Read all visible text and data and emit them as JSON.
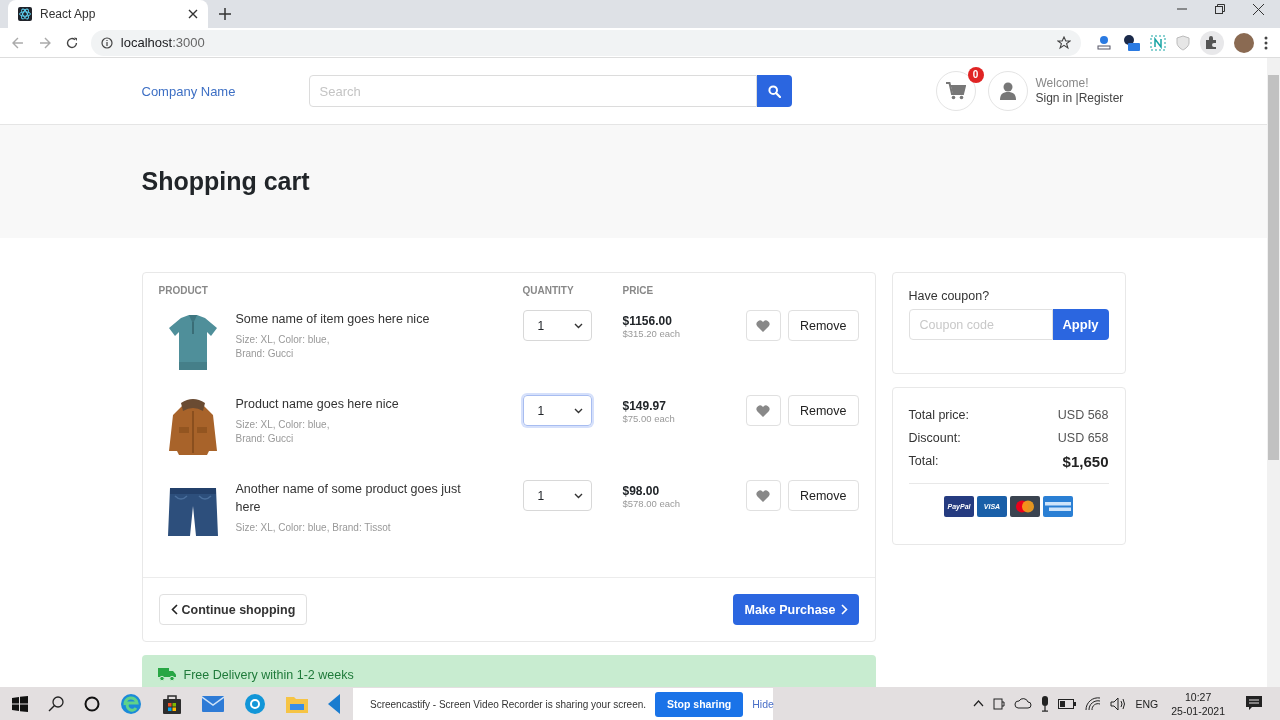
{
  "browser": {
    "tab_title": "React App",
    "url_host": "localhost",
    "url_port": ":3000"
  },
  "header": {
    "brand": "Company Name",
    "search_placeholder": "Search",
    "cart_count": "0",
    "welcome": "Welcome!",
    "sign_in": "Sign in |Register"
  },
  "page_title": "Shopping cart",
  "cart": {
    "columns": [
      "PRODUCT",
      "QUANTITY",
      "PRICE"
    ],
    "items": [
      {
        "name": "Some name of item goes here nice",
        "details": "Size: XL, Color: blue,\nBrand: Gucci",
        "quantity": "1",
        "focused": false,
        "total": "$1156.00",
        "each": "$315.20 each",
        "button": "Remove"
      },
      {
        "name": "Product name goes here nice",
        "details": "Size: XL, Color: blue,\nBrand: Gucci",
        "quantity": "1",
        "focused": true,
        "total": "$149.97",
        "each": "$75.00 each",
        "button": "Remove"
      },
      {
        "name": "Another name of some product goes just here",
        "details": "Size: XL, Color: blue, Brand: Tissot",
        "quantity": "1",
        "focused": false,
        "total": "$98.00",
        "each": "$578.00 each",
        "button": "Remove"
      }
    ],
    "continue": "Continue shopping",
    "purchase": "Make Purchase"
  },
  "coupon": {
    "label": "Have coupon?",
    "placeholder": "Coupon code",
    "button": "Apply"
  },
  "summary": {
    "rows": [
      {
        "kind": "normal",
        "label": "Total price:",
        "value": "USD 568"
      },
      {
        "kind": "normal",
        "label": "Discount:",
        "value": "USD 658"
      },
      {
        "kind": "total",
        "label": "Total:",
        "value": "$1,650"
      }
    ],
    "payment_methods": [
      {
        "kind": "text",
        "label": "PayPal",
        "color": "#253b80"
      },
      {
        "kind": "text",
        "label": "VISA",
        "color": "#1a5fa8"
      },
      {
        "kind": "circles",
        "color": "#3a4350"
      },
      {
        "kind": "stripes",
        "color": "#2a7fd4"
      }
    ]
  },
  "delivery": "Free Delivery within 1-2 weeks",
  "screencastify": {
    "message": "Screencastify - Screen Video Recorder is sharing your screen.",
    "stop": "Stop sharing",
    "hide": "Hide"
  },
  "taskbar": {
    "language": "ENG",
    "time": "10:27",
    "date": "25-01-2021"
  }
}
